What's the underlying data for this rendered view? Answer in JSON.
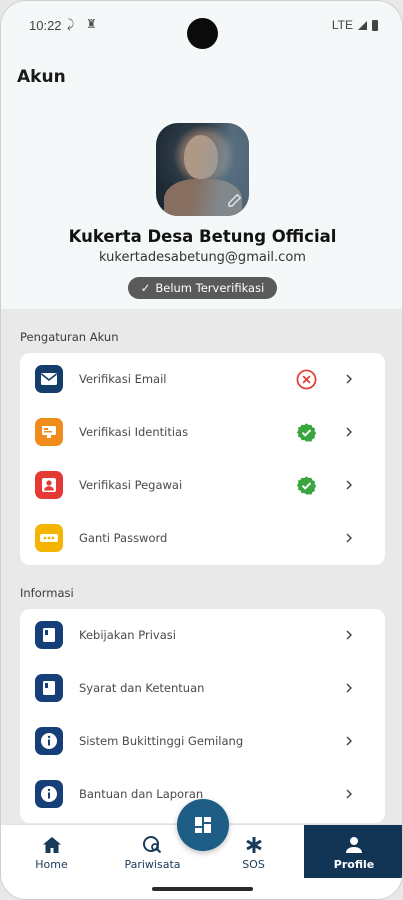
{
  "status": {
    "time": "10:22",
    "network": "LTE"
  },
  "header": {
    "title": "Akun"
  },
  "profile": {
    "name": "Kukerta Desa Betung Official",
    "email": "kukertadesabetung@gmail.com",
    "badge": "Belum Terverifikasi"
  },
  "account_settings": {
    "title": "Pengaturan Akun",
    "items": [
      {
        "label": "Verifikasi Email",
        "icon": "envelope-icon",
        "icon_color": "#143d6b",
        "status": "not-verified"
      },
      {
        "label": "Verifikasi Identitias",
        "icon": "id-card-icon",
        "icon_color": "#f08c1b",
        "status": "verified"
      },
      {
        "label": "Verifikasi Pegawai",
        "icon": "person-icon",
        "icon_color": "#e53935",
        "status": "verified"
      },
      {
        "label": "Ganti Password",
        "icon": "password-icon",
        "icon_color": "#f4b400",
        "status": "none"
      }
    ]
  },
  "info": {
    "title": "Informasi",
    "items": [
      {
        "label": "Kebijakan Privasi",
        "icon": "book-icon"
      },
      {
        "label": "Syarat dan Ketentuan",
        "icon": "book-icon"
      },
      {
        "label": "Sistem Bukittinggi Gemilang",
        "icon": "info-icon"
      },
      {
        "label": "Bantuan dan Laporan",
        "icon": "info-icon"
      }
    ]
  },
  "nav": {
    "home": "Home",
    "pariwisata": "Pariwisata",
    "sos": "SOS",
    "profile": "Profile"
  },
  "colors": {
    "primary": "#123556",
    "verified": "#3aa53f",
    "error": "#e53935"
  }
}
